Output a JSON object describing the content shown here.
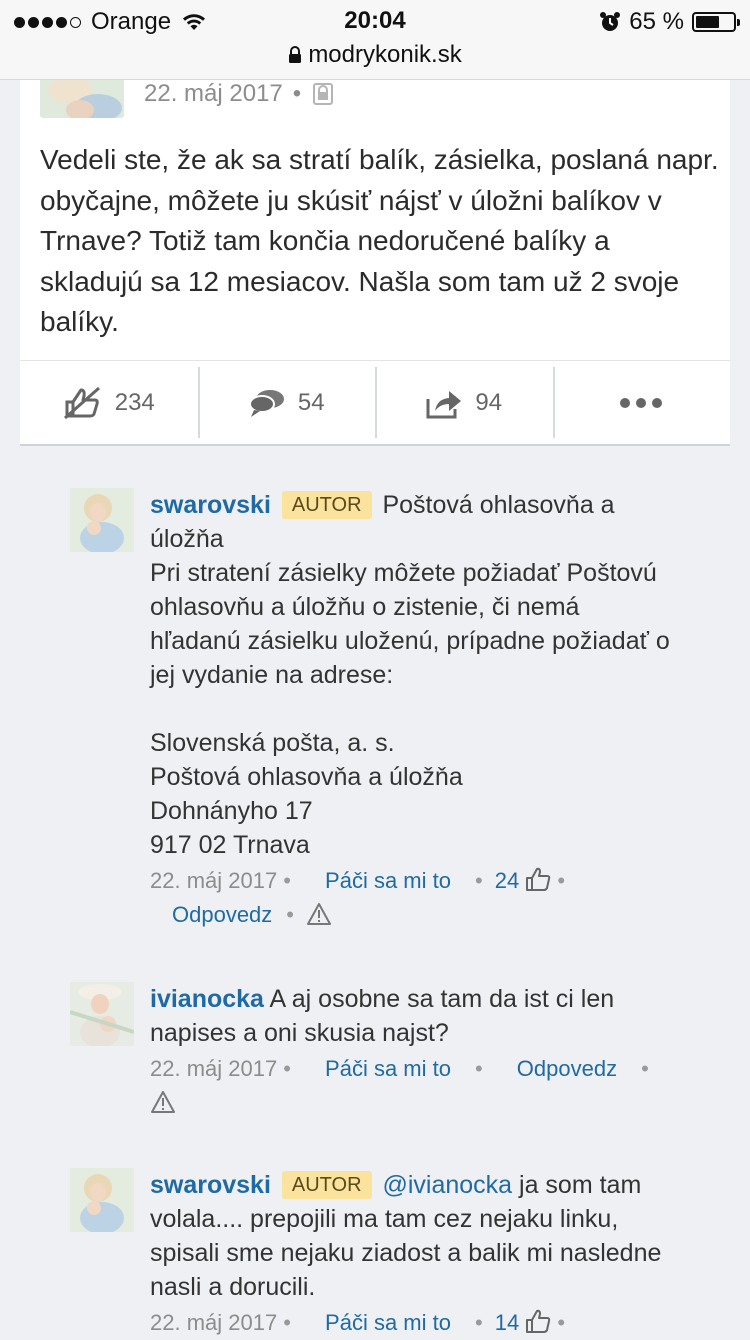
{
  "status_bar": {
    "carrier": "Orange",
    "time": "20:04",
    "battery": "65 %",
    "battery_level": 0.65,
    "url": "modrykonik.sk"
  },
  "post": {
    "date": "22. máj 2017",
    "dot": "•",
    "text": "Vedeli ste, že ak sa stratí balík, zásielka, poslaná napr. obyčajne, môžete ju skúsiť nájsť v úložni balíkov v Trnave? Totiž tam končia nedoručené balíky a skladujú sa 12 mesiacov. Našla som tam už 2 svoje balíky.",
    "actions": {
      "likes": "234",
      "comments": "54",
      "shares": "94"
    }
  },
  "comments": [
    {
      "author": "swarovski",
      "badge": "AUTOR",
      "text": "Poštová ohlasovňa a úložňa\nPri stratení zásielky môžete požiadať Poštovú ohlasovňu a úložňu o zistenie, či nemá hľadanú zásielku uloženú, prípadne požiadať o jej vydanie na adrese:\n\nSlovenská pošta, a. s.\nPoštová ohlasovňa a úložňa\nDohnányho 17\n917 02 Trnava",
      "date": "22. máj 2017",
      "like_label": "Páči sa mi to",
      "like_count": "24",
      "reply_label": "Odpovedz"
    },
    {
      "author": "ivianocka",
      "text": "A aj osobne sa tam da ist ci len napises a oni skusia najst?",
      "date": "22. máj 2017",
      "like_label": "Páči sa mi to",
      "reply_label": "Odpovedz"
    },
    {
      "author": "swarovski",
      "badge": "AUTOR",
      "mention": "@ivianocka",
      "text": " ja som tam volala.... prepojili ma tam cez nejaku linku, spisali sme nejaku ziadost a balik mi nasledne nasli a dorucili.",
      "date": "22. máj 2017",
      "like_label": "Páči sa mi to",
      "like_count": "14"
    }
  ],
  "colors": {
    "accent": "#1f6aa5",
    "badge_bg": "#fbe39d",
    "page_bg": "#eef0f3"
  }
}
